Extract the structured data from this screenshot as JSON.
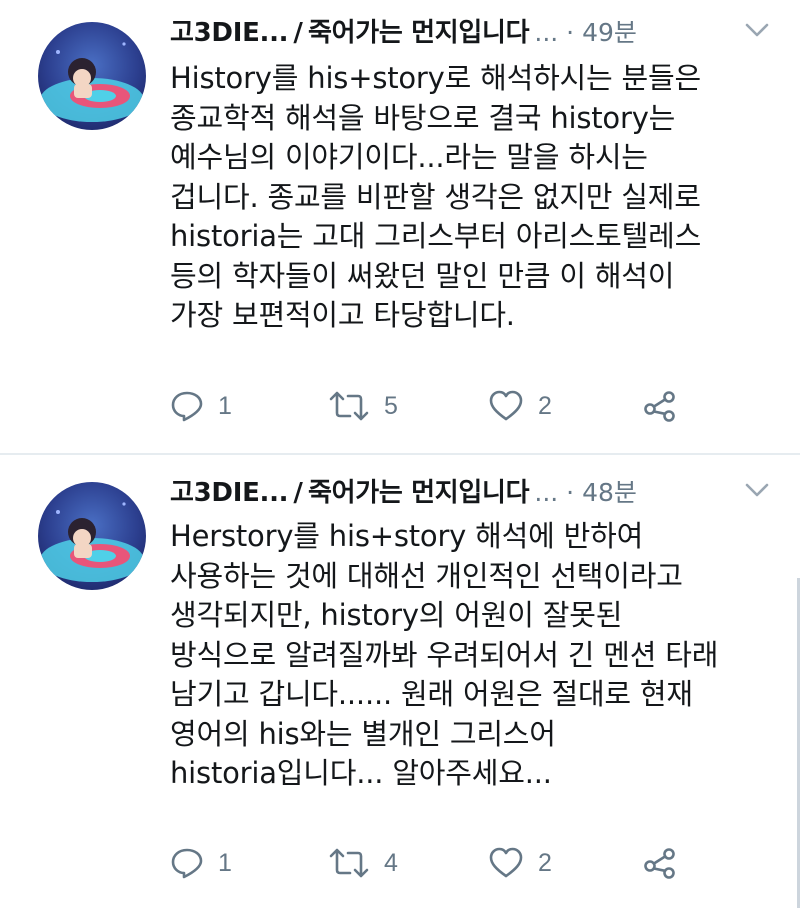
{
  "tweets": [
    {
      "name": "고3DIE...",
      "separator": "/",
      "display_name": "죽어가는 먼지입니다",
      "time": "... · 49분",
      "body_lines": [
        "History를 his+story로 해석하시는 분들은",
        "종교학적 해석을 바탕으로 결국 history는",
        "예수님의 이야기이다...라는 말을 하시는",
        "겁니다. 종교를 비판할 생각은 없지만 실제로",
        "historia는 고대 그리스부터 아리스토텔레스",
        "등의 학자들이 써왔던 말인 만큼 이 해석이",
        "가장 보편적이고 타당합니다."
      ],
      "replies": "1",
      "retweets": "5",
      "likes": "2"
    },
    {
      "name": "고3DIE...",
      "separator": "/",
      "display_name": "죽어가는 먼지입니다",
      "time": "... · 48분",
      "body_lines": [
        "Herstory를 his+story 해석에 반하여",
        "사용하는 것에 대해선 개인적인 선택이라고",
        "생각되지만, history의 어원이 잘못된",
        "방식으로 알려질까봐 우려되어서 긴 멘션 타래",
        "남기고 갑니다...... 원래 어원은 절대로 현재",
        "영어의 his와는 별개인 그리스어",
        "historia입니다... 알아주세요..."
      ],
      "replies": "1",
      "retweets": "4",
      "likes": "2"
    }
  ],
  "icons": {
    "reply": "reply-icon",
    "retweet": "retweet-icon",
    "like": "heart-icon",
    "share": "share-icon",
    "caret": "chevron-down-icon"
  },
  "colors": {
    "text": "#14171a",
    "secondary": "#657786",
    "divider": "#e6ecf0"
  }
}
